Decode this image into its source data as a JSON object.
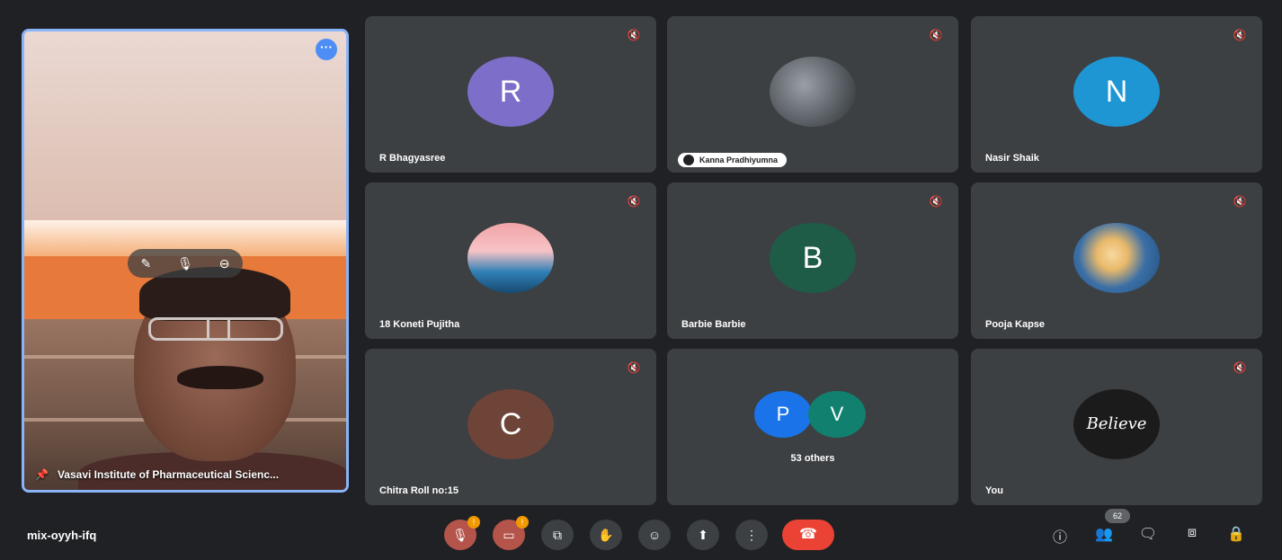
{
  "meeting": {
    "code": "mix-oyyh-ifq"
  },
  "speaker": {
    "name": "Vasavi Institute of Pharmaceutical Scienc..."
  },
  "tiles": [
    {
      "name": "R Bhagyasree",
      "initial": "R",
      "color": "#7d6fc9"
    },
    {
      "name": "Kanna Pradhiyumna"
    },
    {
      "name": "Nasir Shaik",
      "initial": "N",
      "color": "#1e96d4"
    },
    {
      "name": "18 Koneti Pujitha"
    },
    {
      "name": "Barbie Barbie",
      "initial": "B",
      "color": "#1e5c48"
    },
    {
      "name": "Pooja Kapse"
    },
    {
      "name": "Chitra Roll no:15",
      "initial": "C",
      "color": "#6e4338"
    },
    {
      "others": "53 others",
      "p_initial": "P",
      "v_initial": "V"
    },
    {
      "name": "You",
      "avatar_text": "Believe"
    }
  ],
  "controls": {
    "participants_count": "62",
    "mic_badge": "!",
    "cam_badge": "!"
  },
  "icons": {
    "more": "more-horizontal-icon",
    "mute": "mic-off-icon",
    "pin": "pin-icon"
  }
}
